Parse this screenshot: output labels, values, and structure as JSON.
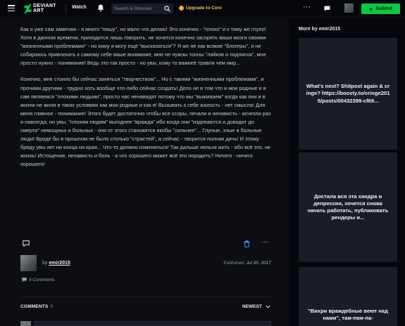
{
  "topbar": {
    "logo_text": "DEVIANT ART",
    "watch_label": "Watch",
    "search_placeholder": "Search & Discover",
    "upgrade_label": "Upgrade to Core",
    "submit_label": "Submit"
  },
  "article": {
    "paragraphs": [
      "Как я уже сам замечаю - я много \"пишу\", но мало что делаю! Это конечно - \"плохо\" и к тому же глупо! Хотя в данном времени, приходится лишь говорить, не хочется конечно засорять ваши мозги своими \"жизненными проблемами\" - но кому я могу ещё \"высказаться\"? Я же не как всякие \"блогеры\", я не собираюсь привлекать к самому себе ваше внимание, мне не нужны тонны \"лайков и подписок\", мне просто нужно - понимание! Ведь это так просто - но увы, кому то важнее травля чем мир...",
      "Конечно, мне стоило бы сейчас заняться \"творчеством\"... Но с такими \"жизненными проблемами\", и прочими другими - трудно хоть вообще что-либо сейчас создать! Дело не в том что я мои родные и я сам являемся \"плохими людьми\", просто нас ненавидят потому что мы \"выживаем\" когда как они и в жизни не жили в таких условиях как мои родные и как я! Вызывать к себе жалость - нет смысла! Для меня главное - понимание! Этого будет достаточно чтобы все ссоры, печали и ненависть - исчезли раз и навсегда, но увы, \"плохим людям\" выгоднее \"вражда\" ибо когда они \"издеваются и доводят до смерти\" немощных и больных - они от этого становятся якобы \"сильнее\"... Глупые, злые и больные люди! Вроде бы в прошлом не было столько \"страстей\", а сейчас - творится полная дичь! И этому бреду увы нет ни конца ни края... Что-то должно измениться! Так дальше нельзя жить - ибо всё это, не жизнь! Истощение, ненависть и боль - а что хорошего может всё это породить? Ничего - ничего хорошего!"
    ]
  },
  "author": {
    "by_label": "by",
    "name": "emir2015",
    "published_label": "Published:",
    "published_date": "Jul 20, 2017"
  },
  "comments": {
    "count_text": "0 Comments",
    "header_label": "COMMENTS",
    "header_count": "0",
    "sort_label": "NEWEST"
  },
  "sidebar": {
    "title": "More by emir2015",
    "cards": [
      "What's next? Shitpost again & cringe? https://boosty.to/cringe2015/posts/00432399-cf69...",
      "Достала вся эта хандра и депрессия, хочется снова начать работать, публиковать рендеры и...",
      "\"Вихри враждебные веют над нами\", там-пам-па-"
    ]
  },
  "colors": {
    "accent_green": "#05cc47",
    "core_gold": "#f8c54b",
    "background": "#06070d"
  },
  "icons": [
    "menu-icon",
    "deviantart-logo",
    "bell-icon",
    "search-icon",
    "coin-icon",
    "more-icon",
    "chat-icon",
    "plus-icon",
    "comment-icon",
    "trash-icon",
    "chevron-down-icon"
  ]
}
